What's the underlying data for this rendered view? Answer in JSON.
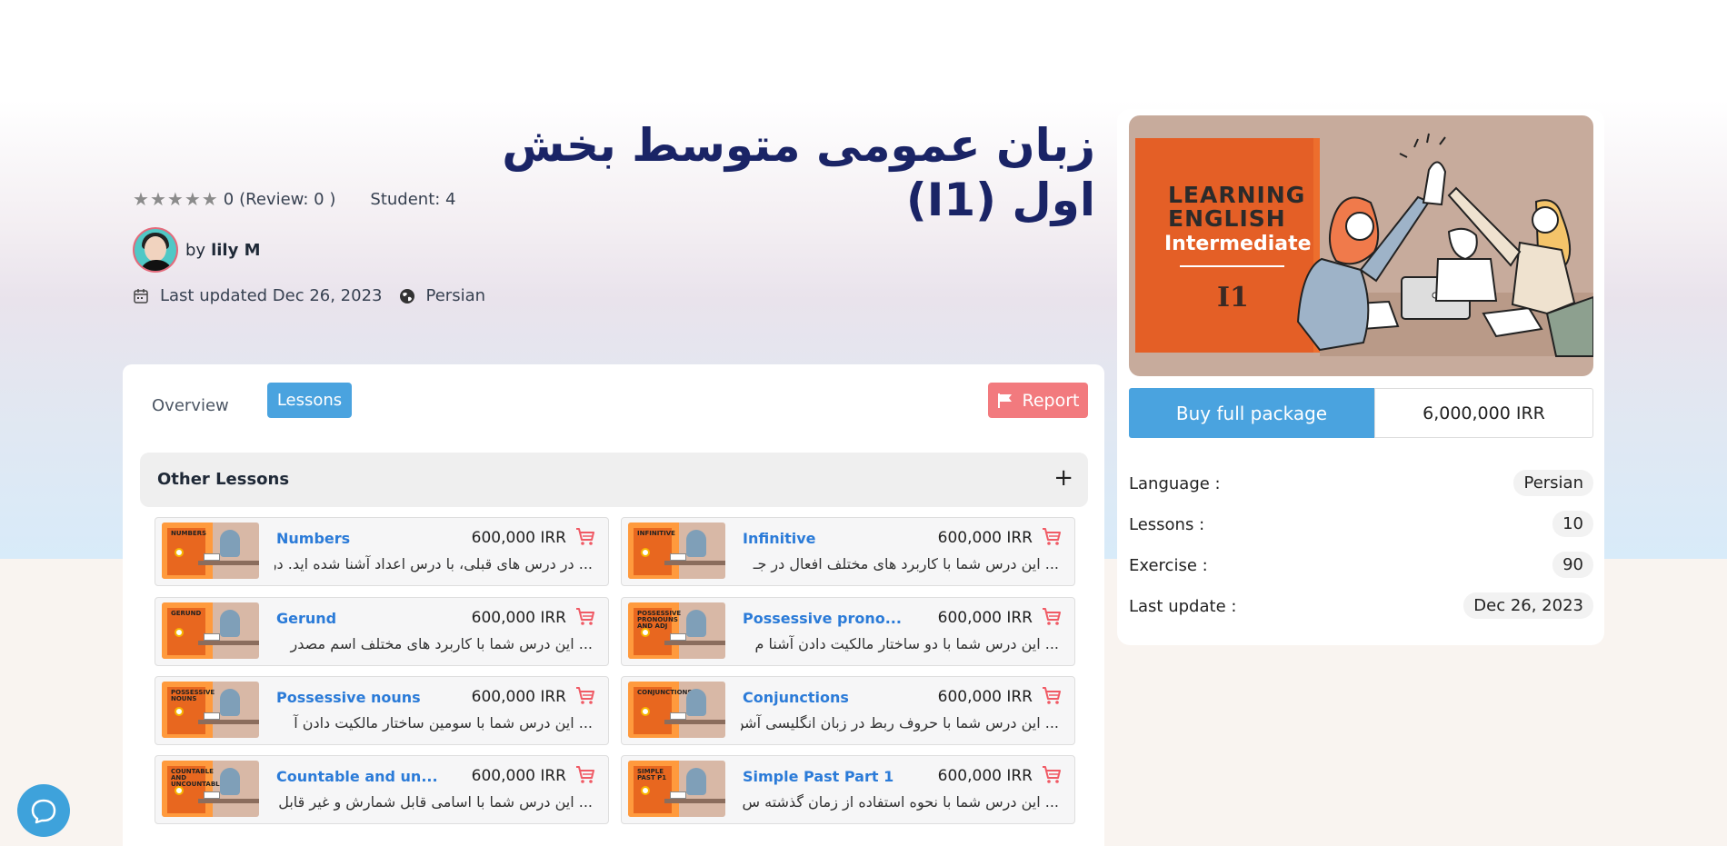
{
  "course": {
    "title": "زبان عمومی متوسط بخش اول (I1)",
    "rating_value": "0",
    "review_text": "(Review: 0 )",
    "students": "Student: 4",
    "by_label": "by",
    "author": "lily M",
    "last_updated": "Last updated Dec 26, 2023",
    "language": "Persian"
  },
  "tabs": {
    "overview": "Overview",
    "lessons": "Lessons",
    "report": "Report"
  },
  "accordion": {
    "label": "Other Lessons",
    "toggle": "+"
  },
  "lessons": [
    {
      "thumb_label": "NUMBERS",
      "name": "Numbers",
      "price": "600,000 IRR",
      "desc": "... در درس های قبلی، با درس اعداد آشنا شده اید. در"
    },
    {
      "thumb_label": "INFINITIVE",
      "name": "Infinitive",
      "price": "600,000 IRR",
      "desc": "... این درس شما با کاربرد های مختلف افعال در جـ"
    },
    {
      "thumb_label": "GERUND",
      "name": "Gerund",
      "price": "600,000 IRR",
      "desc": "... این درس شما با کاربرد های مختلف اسم مصدر"
    },
    {
      "thumb_label": "POSSESSIVE PRONOUNS AND ADJ",
      "name": "Possessive prono...",
      "price": "600,000 IRR",
      "desc": "... این درس شما با دو ساختار مالکیت دادن آشنا م"
    },
    {
      "thumb_label": "POSSESSIVE NOUNS",
      "name": "Possessive nouns",
      "price": "600,000 IRR",
      "desc": "... این درس شما با سومین ساختار مالکیت دادن آ"
    },
    {
      "thumb_label": "CONJUNCTIONS",
      "name": "Conjunctions",
      "price": "600,000 IRR",
      "desc": "... این درس شما با حروف ربط در زبان انگلیسی آشن"
    },
    {
      "thumb_label": "COUNTABLE AND UNCOUNTABLE",
      "name": "Countable and un...",
      "price": "600,000 IRR",
      "desc": "... این درس شما با اسامی قابل شمارش و غیر قابل"
    },
    {
      "thumb_label": "SIMPLE PAST P1",
      "name": "Simple Past Part 1",
      "price": "600,000 IRR",
      "desc": "... این درس شما با نحوه استفاده از زمان گذشته س"
    }
  ],
  "cover": {
    "line1": "LEARNING",
    "line2": "ENGLISH",
    "line3": "Intermediate",
    "level": "I1"
  },
  "purchase": {
    "buy_label": "Buy full package",
    "price": "6,000,000 IRR"
  },
  "info": [
    {
      "key": "Language :",
      "value": "Persian"
    },
    {
      "key": "Lessons :",
      "value": "10"
    },
    {
      "key": "Exercise :",
      "value": "90"
    },
    {
      "key": "Last update :",
      "value": "Dec 26, 2023"
    }
  ],
  "colors": {
    "accent": "#4aa3df",
    "report": "#f27a7e",
    "title": "#1a2466",
    "lesson_link": "#2b7bd8",
    "cart": "#f05a65"
  },
  "icons": {
    "rating": "star-icon",
    "calendar": "calendar-icon",
    "language": "globe-icon",
    "report": "flag-icon",
    "cart": "cart-icon",
    "chat": "chat-icon"
  }
}
